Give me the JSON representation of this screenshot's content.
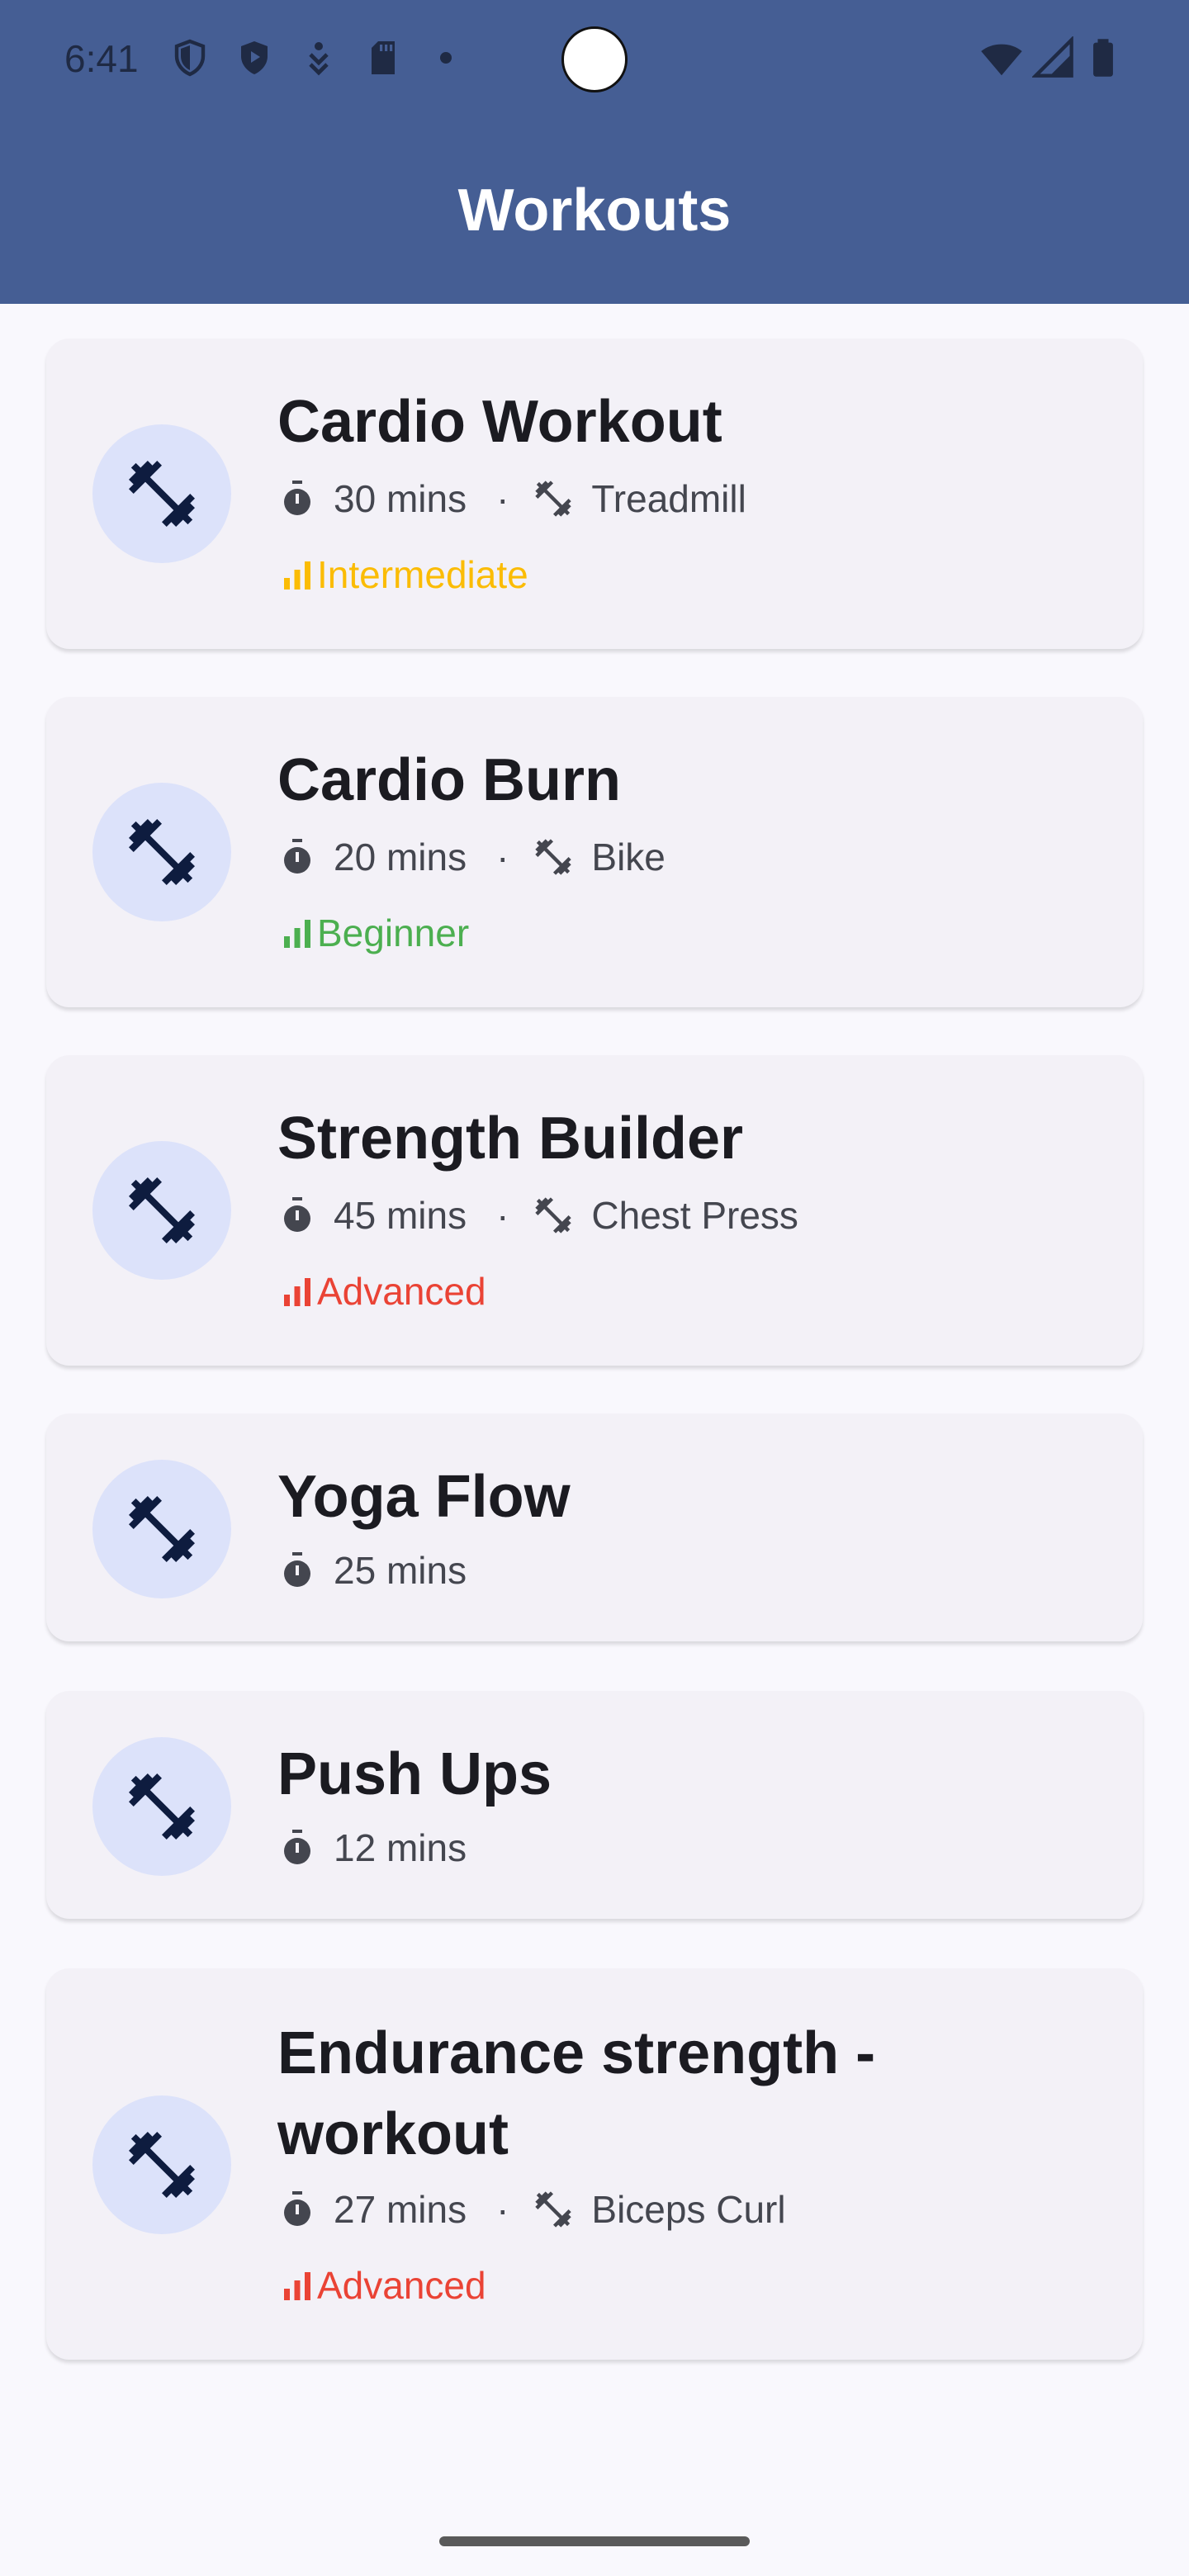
{
  "status_bar": {
    "time": "6:41",
    "icons": [
      "shield-icon",
      "shield-play-icon",
      "download-icon",
      "sd-card-icon",
      "dot-icon",
      "wifi-icon",
      "signal-icon",
      "battery-icon"
    ]
  },
  "app_bar": {
    "title": "Workouts",
    "color": "#455E94"
  },
  "colors": {
    "intermediate": "#FBBC05",
    "beginner": "#4CAF50",
    "advanced": "#EA4335",
    "avatar_bg": "#DCE2FA",
    "icon_dark": "#0E1C3F"
  },
  "workouts": [
    {
      "title": "Cardio Workout",
      "duration": "30 mins",
      "separator": "·",
      "equipment": "Treadmill",
      "level": "Intermediate"
    },
    {
      "title": "Cardio Burn",
      "duration": "20 mins",
      "separator": "·",
      "equipment": "Bike",
      "level": "Beginner"
    },
    {
      "title": "Strength Builder",
      "duration": "45 mins",
      "separator": "·",
      "equipment": "Chest Press",
      "level": "Advanced"
    },
    {
      "title": "Yoga Flow",
      "duration": "25 mins"
    },
    {
      "title": "Push Ups",
      "duration": "12 mins"
    },
    {
      "title": "Endurance strength - workout",
      "duration": "27 mins",
      "separator": "·",
      "equipment": "Biceps Curl",
      "level": "Advanced"
    }
  ]
}
